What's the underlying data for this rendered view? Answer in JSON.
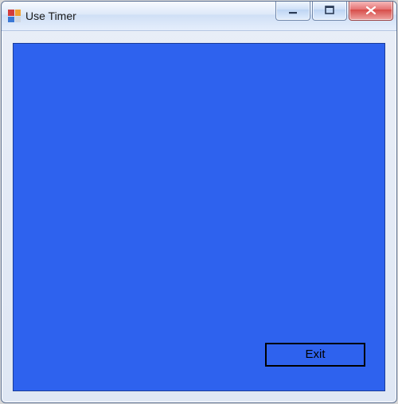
{
  "window": {
    "title": "Use Timer"
  },
  "buttons": {
    "exit_label": "Exit"
  }
}
